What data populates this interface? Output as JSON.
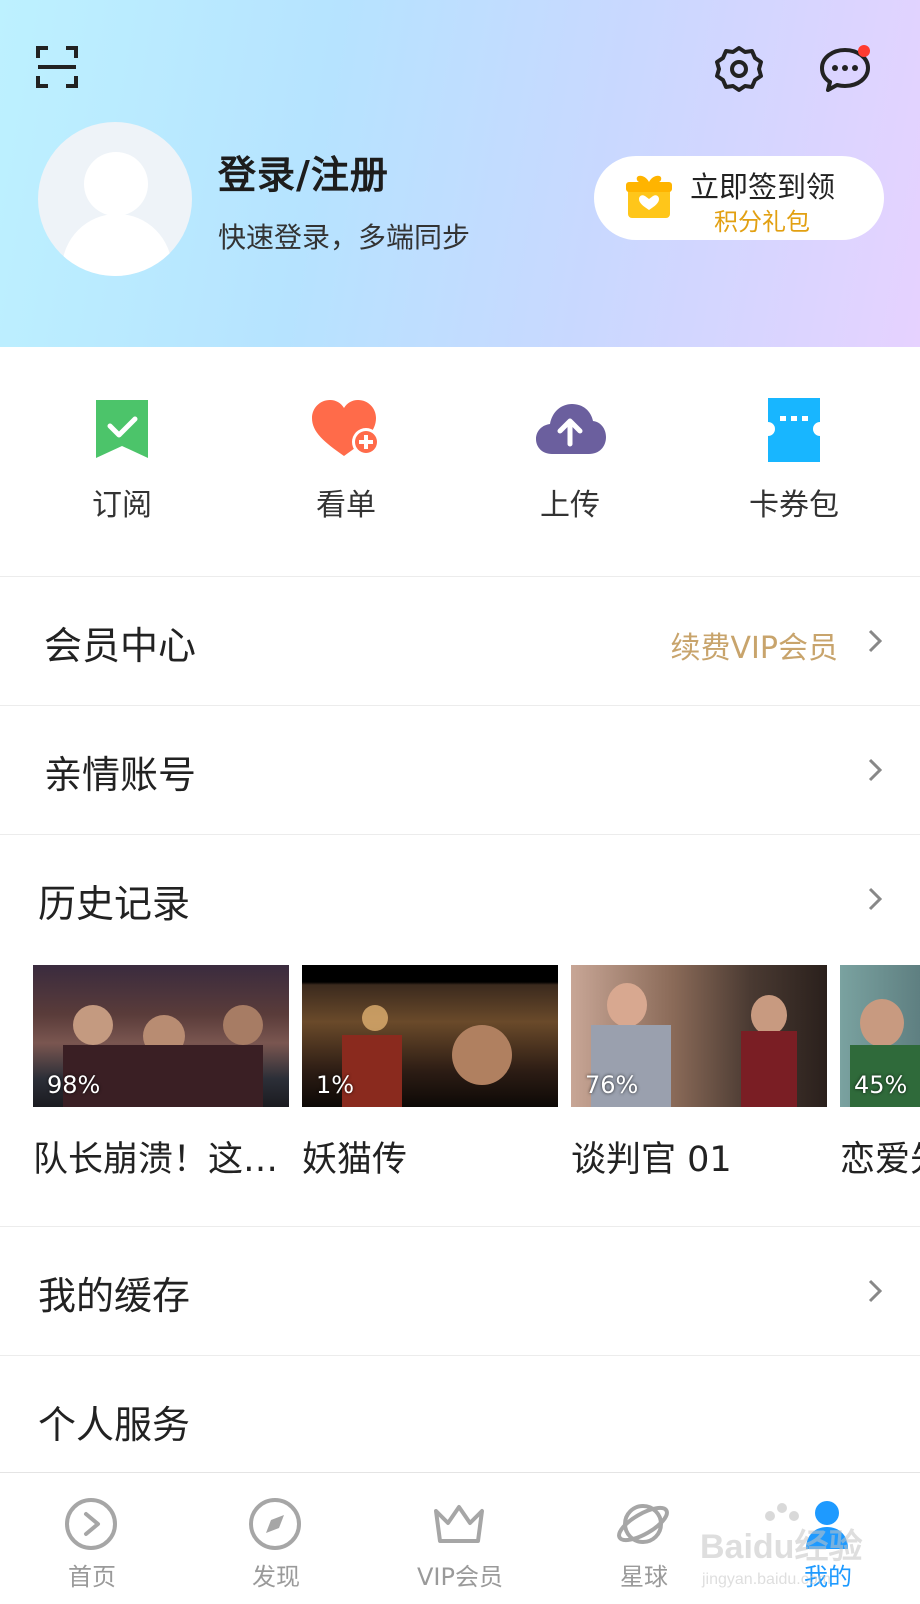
{
  "header": {
    "login_title": "登录/注册",
    "login_subtitle": "快速登录，多端同步",
    "checkin_line1": "立即签到领",
    "checkin_line2": "积分礼包",
    "has_message_dot": true
  },
  "quick_actions": [
    {
      "label": "订阅",
      "icon": "subscribe-bookmark-icon",
      "color": "#4cc46a"
    },
    {
      "label": "看单",
      "icon": "heart-plus-icon",
      "color": "#ff6b4a"
    },
    {
      "label": "上传",
      "icon": "cloud-upload-icon",
      "color": "#6b5f9e"
    },
    {
      "label": "卡券包",
      "icon": "ticket-icon",
      "color": "#18b6ff"
    }
  ],
  "menu": {
    "vip_center": "会员中心",
    "vip_renew": "续费VIP会员",
    "family_account": "亲情账号",
    "history": "历史记录",
    "my_cache": "我的缓存",
    "personal_service": "个人服务"
  },
  "history_items": [
    {
      "title": "队长崩溃！这…",
      "progress": "98%"
    },
    {
      "title": "妖猫传",
      "progress": "1%"
    },
    {
      "title": "谈判官 01",
      "progress": "76%"
    },
    {
      "title": "恋爱先",
      "progress": "45%"
    }
  ],
  "tabbar": [
    {
      "label": "首页",
      "icon": "home-play-icon"
    },
    {
      "label": "发现",
      "icon": "compass-icon"
    },
    {
      "label": "VIP会员",
      "icon": "crown-icon"
    },
    {
      "label": "星球",
      "icon": "planet-icon"
    },
    {
      "label": "我的",
      "icon": "profile-icon",
      "active": true
    }
  ],
  "watermark": {
    "line1": "Baidu经验",
    "line2": "jingyan.baidu.com"
  },
  "colors": {
    "accent": "#1e9aff",
    "vip_gold": "#c8a46c",
    "checkin_gold": "#e2a012",
    "notify_red": "#ff3b30"
  }
}
